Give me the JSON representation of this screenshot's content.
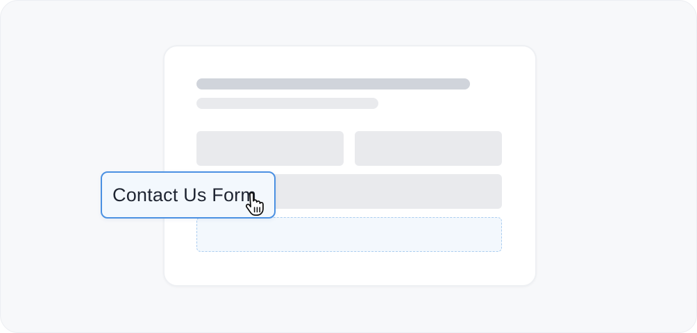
{
  "drag_item": {
    "label": "Contact Us Form",
    "cursor_icon": "grab-hand-icon"
  },
  "colors": {
    "background": "#f7f8fa",
    "card": "#ffffff",
    "skeleton_dark": "#d0d4db",
    "skeleton_light": "#e9eaed",
    "accent": "#4a90e2",
    "drop_zone_fill": "#f3f8fd",
    "drop_zone_border": "#a9ccf0",
    "text": "#1f2532"
  }
}
